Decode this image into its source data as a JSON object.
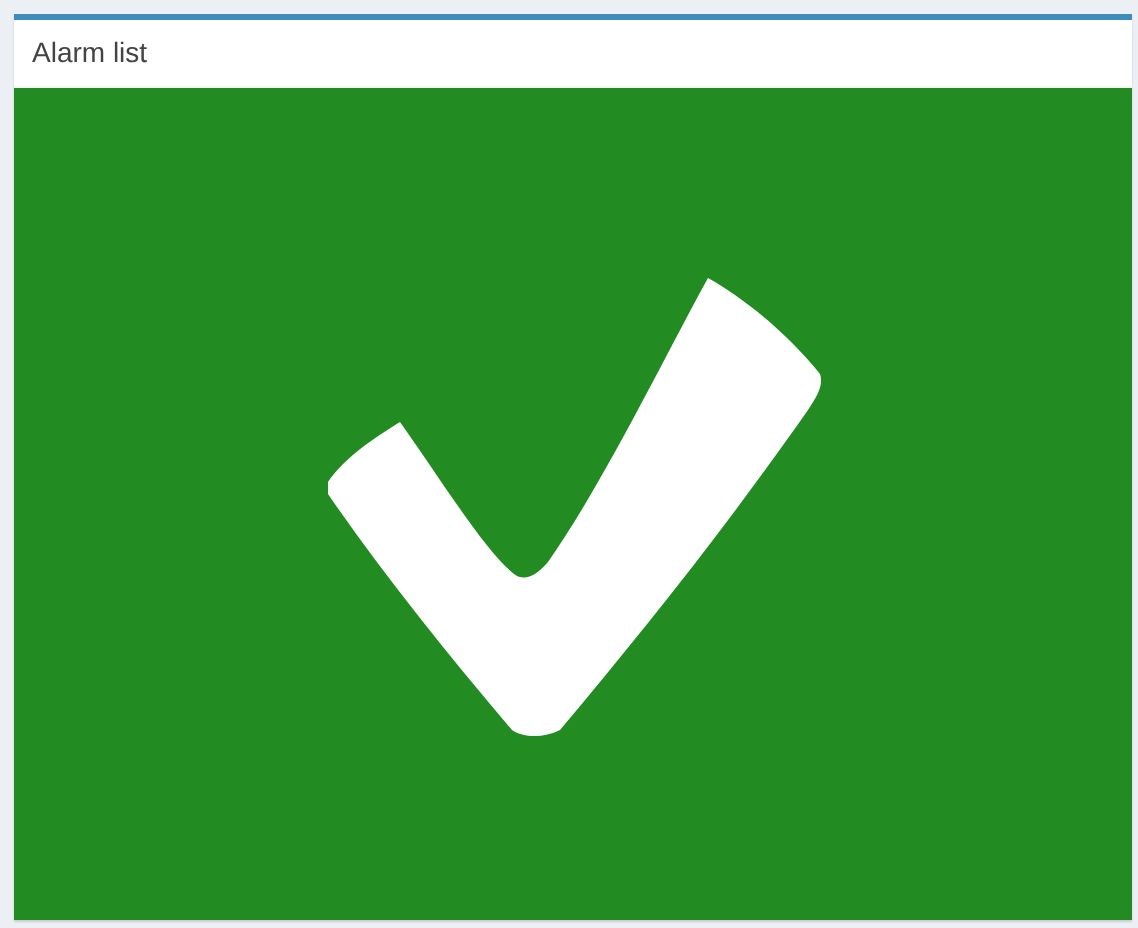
{
  "panel": {
    "title": "Alarm list",
    "ok": true
  }
}
